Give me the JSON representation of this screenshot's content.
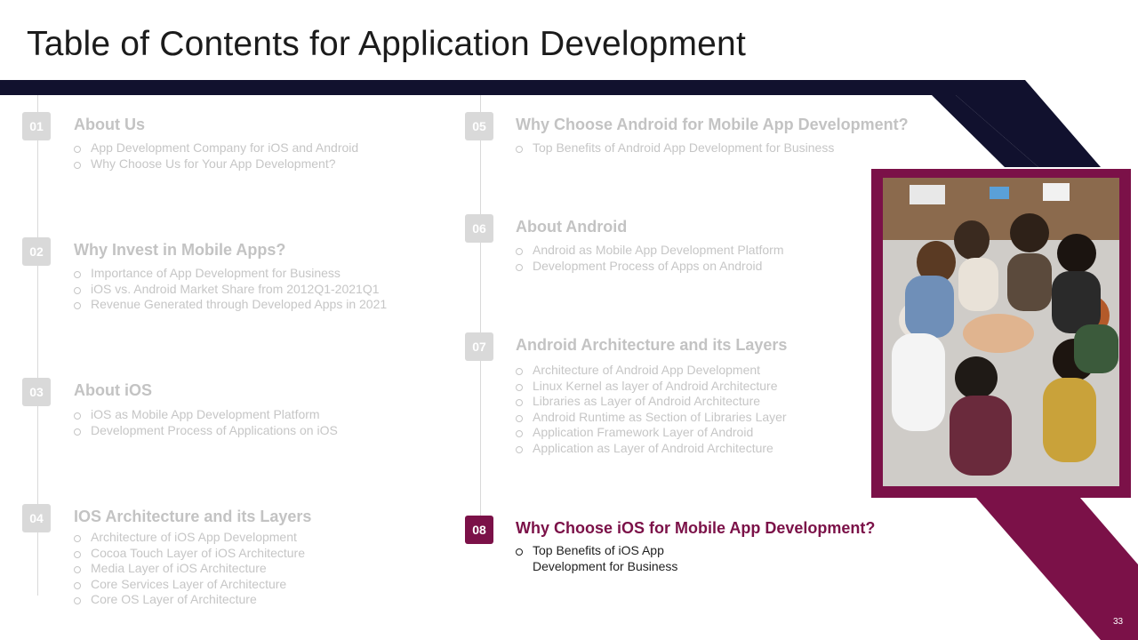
{
  "title": "Table of Contents for Application Development",
  "colors": {
    "navy": "#11112e",
    "maroon": "#7b1148",
    "muted": "#c3c3c3"
  },
  "page_number": "33",
  "photo": {
    "icon": "team-huddle-photo"
  },
  "sections": [
    {
      "num": "01",
      "title": "About Us",
      "items": [
        "App Development Company for iOS and Android",
        "Why Choose Us for Your App Development?"
      ]
    },
    {
      "num": "02",
      "title": "Why Invest in Mobile Apps?",
      "items": [
        "Importance of App Development for Business",
        "iOS vs. Android Market Share from 2012Q1-2021Q1",
        "Revenue Generated through Developed Apps in 2021"
      ]
    },
    {
      "num": "03",
      "title": "About iOS",
      "items": [
        "iOS as Mobile App Development Platform",
        "Development Process of Applications on iOS"
      ]
    },
    {
      "num": "04",
      "title": "IOS Architecture and its Layers",
      "items": [
        "Architecture of iOS App Development",
        "Cocoa Touch Layer of iOS Architecture",
        "Media Layer of iOS Architecture",
        "Core Services Layer of Architecture",
        "Core OS Layer of Architecture"
      ]
    },
    {
      "num": "05",
      "title": "Why Choose Android for Mobile App Development?",
      "items": [
        "Top Benefits of Android App Development for Business"
      ]
    },
    {
      "num": "06",
      "title": "About Android",
      "items": [
        "Android as Mobile App Development Platform",
        "Development Process of Apps on Android"
      ]
    },
    {
      "num": "07",
      "title": "Android Architecture and its Layers",
      "items": [
        "Architecture of Android App Development",
        "Linux Kernel as layer of Android Architecture",
        "Libraries as Layer of Android Architecture",
        "Android Runtime as Section of Libraries Layer",
        "Application Framework Layer of Android",
        "Application as Layer of Android Architecture"
      ]
    },
    {
      "num": "08",
      "title": "Why Choose iOS for Mobile App Development?",
      "items": [
        "Top Benefits of iOS App",
        "Development for Business"
      ]
    }
  ]
}
